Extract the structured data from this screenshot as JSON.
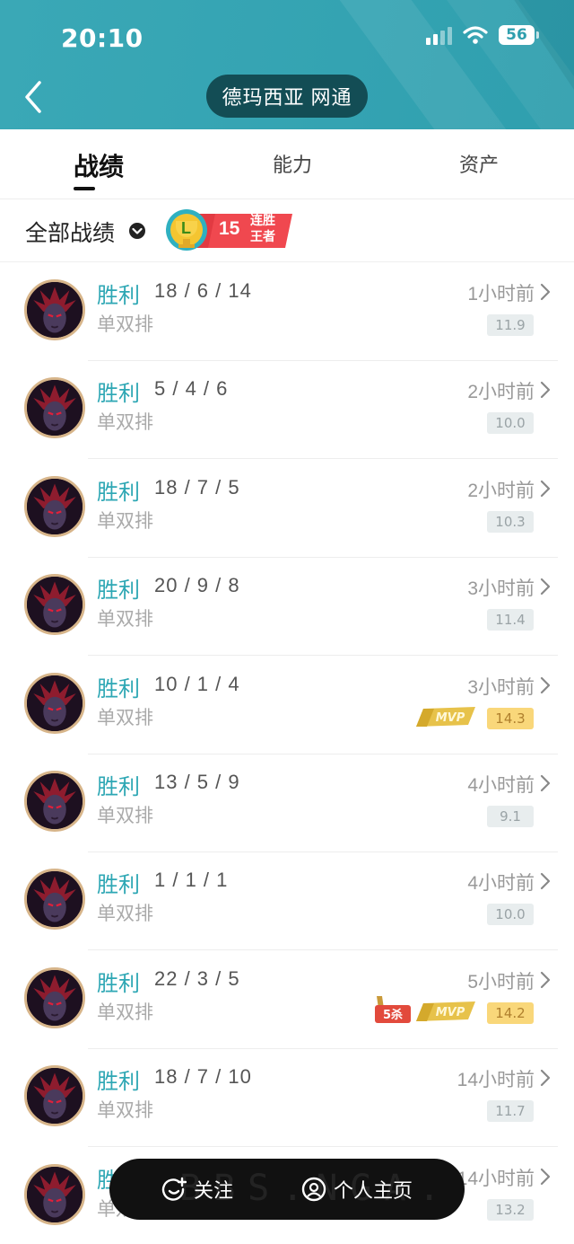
{
  "status_bar": {
    "time": "20:10",
    "battery": "56"
  },
  "header": {
    "server": "德玛西亚 网通"
  },
  "tabs": [
    {
      "label": "战绩",
      "active": true
    },
    {
      "label": "能力",
      "active": false
    },
    {
      "label": "资产",
      "active": false
    }
  ],
  "filter": {
    "label": "全部战绩",
    "streak_count": "15",
    "streak_text_line1": "连胜",
    "streak_text_line2": "王者",
    "streak_icon_letter": "L"
  },
  "matches": [
    {
      "result": "胜利",
      "kda": "18 / 6 / 14",
      "mode": "单双排",
      "time_ago": "1小时前",
      "score": "11.9",
      "mvp": false,
      "penta": false
    },
    {
      "result": "胜利",
      "kda": "5 / 4 / 6",
      "mode": "单双排",
      "time_ago": "2小时前",
      "score": "10.0",
      "mvp": false,
      "penta": false
    },
    {
      "result": "胜利",
      "kda": "18 / 7 / 5",
      "mode": "单双排",
      "time_ago": "2小时前",
      "score": "10.3",
      "mvp": false,
      "penta": false
    },
    {
      "result": "胜利",
      "kda": "20 / 9 / 8",
      "mode": "单双排",
      "time_ago": "3小时前",
      "score": "11.4",
      "mvp": false,
      "penta": false
    },
    {
      "result": "胜利",
      "kda": "10 / 1 / 4",
      "mode": "单双排",
      "time_ago": "3小时前",
      "score": "14.3",
      "mvp": true,
      "penta": false
    },
    {
      "result": "胜利",
      "kda": "13 / 5 / 9",
      "mode": "单双排",
      "time_ago": "4小时前",
      "score": "9.1",
      "mvp": false,
      "penta": false
    },
    {
      "result": "胜利",
      "kda": "1 / 1 / 1",
      "mode": "单双排",
      "time_ago": "4小时前",
      "score": "10.0",
      "mvp": false,
      "penta": false
    },
    {
      "result": "胜利",
      "kda": "22 / 3 / 5",
      "mode": "单双排",
      "time_ago": "5小时前",
      "score": "14.2",
      "mvp": true,
      "penta": true
    },
    {
      "result": "胜利",
      "kda": "18 / 7 / 10",
      "mode": "单双排",
      "time_ago": "14小时前",
      "score": "11.7",
      "mvp": false,
      "penta": false
    },
    {
      "result": "胜利",
      "kda": "",
      "mode": "单双排",
      "time_ago": "14小时前",
      "score": "13.2",
      "mvp": false,
      "penta": false
    }
  ],
  "badges": {
    "mvp_text": "MVP",
    "penta_text": "5杀"
  },
  "bottom_bar": {
    "follow_label": "关注",
    "profile_label": "个人主页"
  },
  "watermark": "BBS.NGA.",
  "colors": {
    "header": "#34a3b2",
    "result_win": "#2ea7b4",
    "score_bg": "#e8edee",
    "mvp_score_bg": "#f9d77a",
    "pill_bg": "#134d55"
  }
}
